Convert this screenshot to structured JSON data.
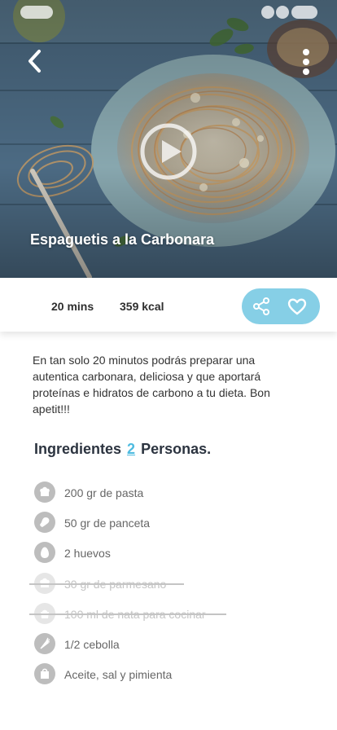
{
  "hero": {
    "title": "Espaguetis a la Carbonara"
  },
  "info": {
    "time": "20 mins",
    "calories": "359 kcal"
  },
  "icons": {
    "back": "chevron-left-icon",
    "more": "more-vertical-icon",
    "play": "play-icon",
    "share": "share-icon",
    "favorite": "heart-icon"
  },
  "colors": {
    "accent": "#86cfe6",
    "servings": "#4ebbe0",
    "icon_gray": "#bdbdbd"
  },
  "description": "En tan solo 20 minutos podrás preparar una autentica carbonara, deliciosa y que aportará proteínas e hidratos de carbono a tu dieta. Bon apetit!!!",
  "ingredients": {
    "heading_prefix": "Ingredientes",
    "servings": "2",
    "heading_suffix": "Personas.",
    "items": [
      {
        "label": "200 gr de pasta",
        "icon": "chef-hat-icon",
        "checked": false
      },
      {
        "label": "50 gr de panceta",
        "icon": "meat-icon",
        "checked": false
      },
      {
        "label": "2 huevos",
        "icon": "egg-icon",
        "checked": false
      },
      {
        "label": "30 gr de parmesano",
        "icon": "chef-hat-icon",
        "checked": true
      },
      {
        "label": "100 ml de nata para cocinar",
        "icon": "cup-icon",
        "checked": true
      },
      {
        "label": "1/2 cebolla",
        "icon": "vegetable-icon",
        "checked": false
      },
      {
        "label": "Aceite, sal y pimienta",
        "icon": "shopping-bag-icon",
        "checked": false
      }
    ]
  }
}
